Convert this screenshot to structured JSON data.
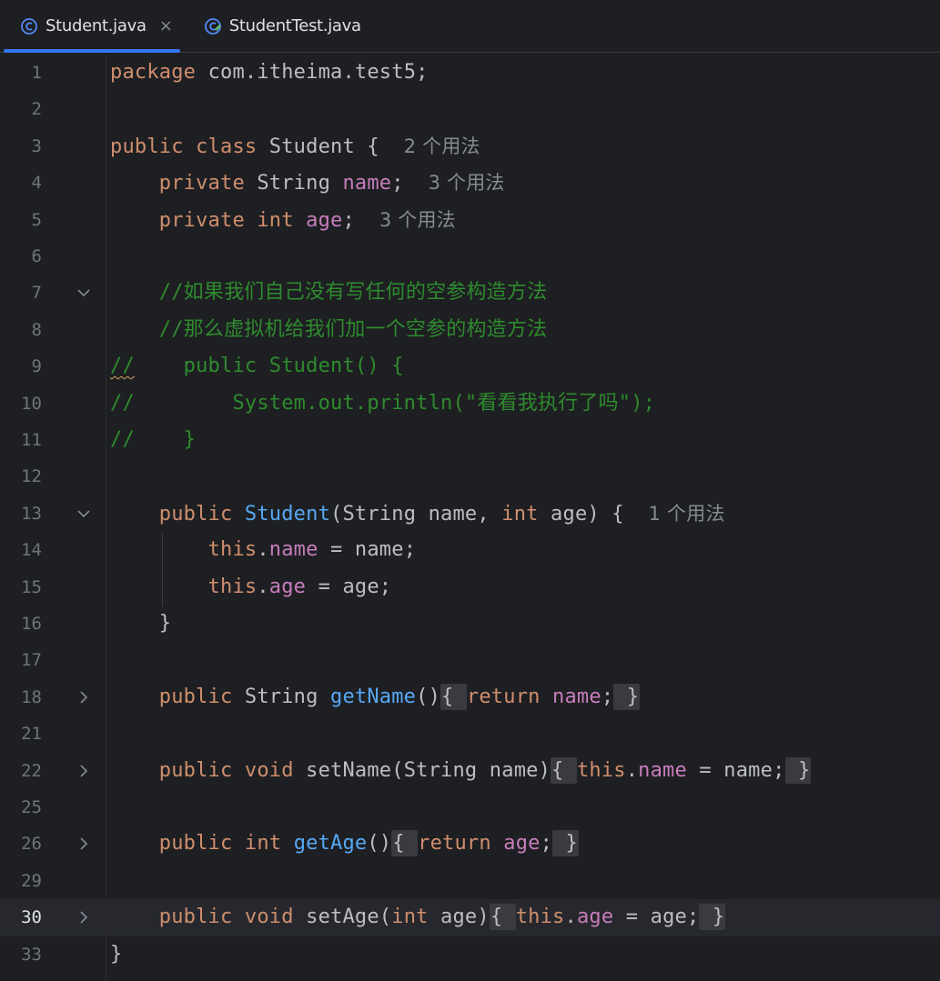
{
  "tabs": [
    {
      "label": "Student.java",
      "active": true,
      "closable": true,
      "icon": "java-class-icon"
    },
    {
      "label": "StudentTest.java",
      "active": false,
      "closable": false,
      "icon": "java-test-class-icon"
    }
  ],
  "tab_close_glyph": "×",
  "colors": {
    "keyword": "#cf8e6d",
    "field": "#c77dbb",
    "method": "#56a8f5",
    "comment": "#2e8b2e",
    "text": "#bcbec4",
    "hint": "#868a91",
    "accent": "#3574f0",
    "background": "#1e1f22"
  },
  "editor": {
    "current_line": "30",
    "lines": [
      {
        "num": "1",
        "fold": "",
        "tokens": [
          [
            "kw",
            "package"
          ],
          [
            "t",
            " com.itheima.test5;"
          ]
        ]
      },
      {
        "num": "2",
        "fold": "",
        "tokens": []
      },
      {
        "num": "3",
        "fold": "",
        "tokens": [
          [
            "kw",
            "public class"
          ],
          [
            "t",
            " Student {  "
          ],
          [
            "hint",
            "2 个用法"
          ]
        ]
      },
      {
        "num": "4",
        "fold": "",
        "tokens": [
          [
            "t",
            "    "
          ],
          [
            "kw",
            "private"
          ],
          [
            "t",
            " String "
          ],
          [
            "fld",
            "name"
          ],
          [
            "t",
            ";  "
          ],
          [
            "hint",
            "3 个用法"
          ]
        ]
      },
      {
        "num": "5",
        "fold": "",
        "tokens": [
          [
            "t",
            "    "
          ],
          [
            "kw",
            "private int"
          ],
          [
            "t",
            " "
          ],
          [
            "fld",
            "age"
          ],
          [
            "t",
            ";  "
          ],
          [
            "hint",
            "3 个用法"
          ]
        ]
      },
      {
        "num": "6",
        "fold": "",
        "tokens": []
      },
      {
        "num": "7",
        "fold": "expanded",
        "tokens": [
          [
            "t",
            "    "
          ],
          [
            "cmt",
            "//如果我们自己没有写任何的空参构造方法"
          ]
        ]
      },
      {
        "num": "8",
        "fold": "",
        "tokens": [
          [
            "t",
            "    "
          ],
          [
            "cmt",
            "//那么虚拟机给我们加一个空参的构造方法"
          ]
        ]
      },
      {
        "num": "9",
        "fold": "",
        "tokens": [
          [
            "cmtsq",
            "//"
          ],
          [
            "cmt",
            "    public Student() {"
          ]
        ]
      },
      {
        "num": "10",
        "fold": "",
        "tokens": [
          [
            "cmt",
            "//        System.out.println(\"看看我执行了吗\");"
          ]
        ]
      },
      {
        "num": "11",
        "fold": "",
        "tokens": [
          [
            "cmt",
            "//    }"
          ]
        ]
      },
      {
        "num": "12",
        "fold": "",
        "tokens": []
      },
      {
        "num": "13",
        "fold": "expanded",
        "tokens": [
          [
            "t",
            "    "
          ],
          [
            "kw",
            "public"
          ],
          [
            "t",
            " "
          ],
          [
            "mth",
            "Student"
          ],
          [
            "t",
            "(String name, "
          ],
          [
            "kw",
            "int"
          ],
          [
            "t",
            " age) {  "
          ],
          [
            "hint",
            "1 个用法"
          ]
        ]
      },
      {
        "num": "14",
        "fold": "",
        "tokens": [
          [
            "t",
            "        "
          ],
          [
            "kw",
            "this"
          ],
          [
            "t",
            "."
          ],
          [
            "fld",
            "name"
          ],
          [
            "t",
            " = name;"
          ]
        ]
      },
      {
        "num": "15",
        "fold": "",
        "tokens": [
          [
            "t",
            "        "
          ],
          [
            "kw",
            "this"
          ],
          [
            "t",
            "."
          ],
          [
            "fld",
            "age"
          ],
          [
            "t",
            " = age;"
          ]
        ]
      },
      {
        "num": "16",
        "fold": "",
        "tokens": [
          [
            "t",
            "    }"
          ]
        ]
      },
      {
        "num": "17",
        "fold": "",
        "tokens": []
      },
      {
        "num": "18",
        "fold": "collapsed",
        "tokens": [
          [
            "t",
            "    "
          ],
          [
            "kw",
            "public"
          ],
          [
            "t",
            " String "
          ],
          [
            "mth",
            "getName"
          ],
          [
            "t",
            "()"
          ],
          [
            "box",
            "{ "
          ],
          [
            "kw",
            "return"
          ],
          [
            "t",
            " "
          ],
          [
            "fld",
            "name"
          ],
          [
            "t",
            ";"
          ],
          [
            "box",
            " }"
          ]
        ]
      },
      {
        "num": "21",
        "fold": "",
        "tokens": []
      },
      {
        "num": "22",
        "fold": "collapsed",
        "tokens": [
          [
            "t",
            "    "
          ],
          [
            "kw",
            "public void"
          ],
          [
            "t",
            " setName(String name)"
          ],
          [
            "box",
            "{ "
          ],
          [
            "kw",
            "this"
          ],
          [
            "t",
            "."
          ],
          [
            "fld",
            "name"
          ],
          [
            "t",
            " = name;"
          ],
          [
            "box",
            " }"
          ]
        ]
      },
      {
        "num": "25",
        "fold": "",
        "tokens": []
      },
      {
        "num": "26",
        "fold": "collapsed",
        "tokens": [
          [
            "t",
            "    "
          ],
          [
            "kw",
            "public int"
          ],
          [
            "t",
            " "
          ],
          [
            "mth",
            "getAge"
          ],
          [
            "t",
            "()"
          ],
          [
            "box",
            "{ "
          ],
          [
            "kw",
            "return"
          ],
          [
            "t",
            " "
          ],
          [
            "fld",
            "age"
          ],
          [
            "t",
            ";"
          ],
          [
            "box",
            " }"
          ]
        ]
      },
      {
        "num": "29",
        "fold": "",
        "tokens": []
      },
      {
        "num": "30",
        "fold": "collapsed",
        "tokens": [
          [
            "t",
            "    "
          ],
          [
            "kw",
            "public void"
          ],
          [
            "t",
            " setAge("
          ],
          [
            "kw",
            "int"
          ],
          [
            "t",
            " age)"
          ],
          [
            "box",
            "{ "
          ],
          [
            "kw",
            "this"
          ],
          [
            "t",
            "."
          ],
          [
            "fld",
            "age"
          ],
          [
            "t",
            " = age;"
          ],
          [
            "box",
            " }"
          ]
        ]
      },
      {
        "num": "33",
        "fold": "",
        "tokens": [
          [
            "t",
            "}"
          ]
        ]
      }
    ]
  }
}
